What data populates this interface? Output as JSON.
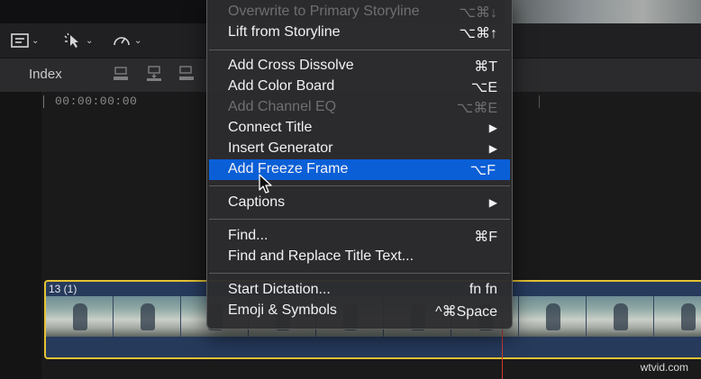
{
  "toolbar": {
    "tools": [
      {
        "icon": "clip-appearance-icon"
      },
      {
        "icon": "select-tool-icon"
      },
      {
        "icon": "speed-retime-icon"
      }
    ]
  },
  "indexbar": {
    "label": "Index"
  },
  "timeline": {
    "timecode": "00:00:00:00"
  },
  "clip": {
    "title": "13 (1)"
  },
  "menu": {
    "items": [
      {
        "label": "Overwrite to Primary Storyline",
        "shortcut": "⌥⌘↓",
        "disabled": true
      },
      {
        "label": "Lift from Storyline",
        "shortcut": "⌥⌘↑"
      },
      {
        "label": "Add Cross Dissolve",
        "shortcut": "⌘T"
      },
      {
        "label": "Add Color Board",
        "shortcut": "⌥E"
      },
      {
        "label": "Add Channel EQ",
        "shortcut": "⌥⌘E",
        "disabled": true
      },
      {
        "label": "Connect Title",
        "shortcut": "▶"
      },
      {
        "label": "Insert Generator",
        "shortcut": "▶"
      },
      {
        "label": "Add Freeze Frame",
        "shortcut": "⌥F",
        "highlighted": true
      },
      {
        "label": "Captions",
        "shortcut": "▶"
      },
      {
        "label": "Find...",
        "shortcut": "⌘F"
      },
      {
        "label": "Find and Replace Title Text..."
      },
      {
        "label": "Start Dictation...",
        "shortcut": "fn fn"
      },
      {
        "label": "Emoji & Symbols",
        "shortcut": "^⌘Space"
      }
    ]
  },
  "watermark": "wtvid.com",
  "colors": {
    "highlight": "#0a5fd7",
    "clip_border": "#e5c233",
    "playhead": "#d23b2f"
  }
}
